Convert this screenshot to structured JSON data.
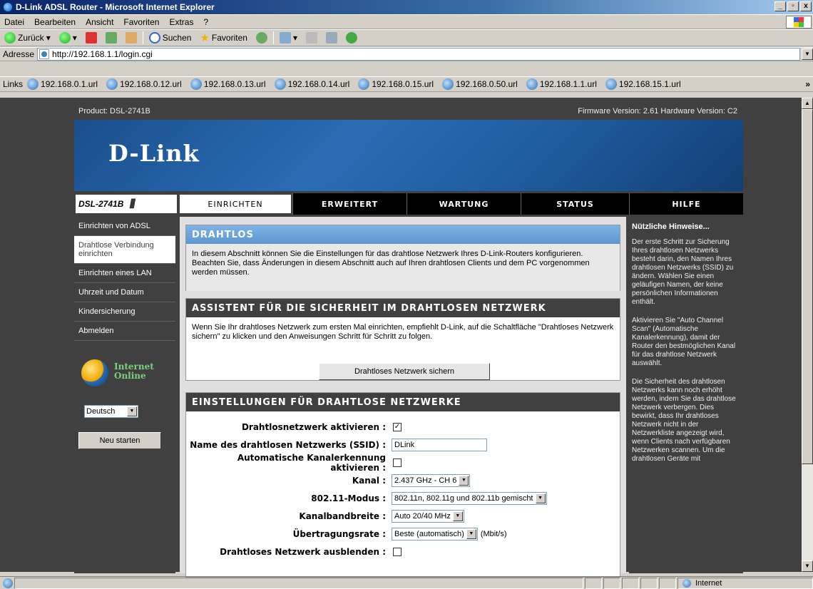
{
  "window": {
    "title": "D-Link ADSL Router - Microsoft Internet Explorer",
    "controls": [
      "_",
      "▫",
      "x"
    ]
  },
  "menubar": [
    "Datei",
    "Bearbeiten",
    "Ansicht",
    "Favoriten",
    "Extras",
    "?"
  ],
  "toolbar": {
    "back": "Zurück",
    "search": "Suchen",
    "favorites": "Favoriten"
  },
  "address": {
    "label": "Adresse",
    "url": "http://192.168.1.1/login.cgi"
  },
  "links": {
    "label": "Links",
    "items": [
      "192.168.0.1.url",
      "192.168.0.12.url",
      "192.168.0.13.url",
      "192.168.0.14.url",
      "192.168.0.15.url",
      "192.168.0.50.url",
      "192.168.1.1.url",
      "192.168.15.1.url"
    ],
    "more": "»"
  },
  "router": {
    "product": "Product: DSL-2741B",
    "firmware": "Firmware Version: 2.61 Hardware Version: C2",
    "logo": "D-Link",
    "model": "DSL-2741B",
    "tabs": [
      "EINRICHTEN",
      "ERWEITERT",
      "WARTUNG",
      "STATUS",
      "HILFE"
    ],
    "nav": [
      "Einrichten von ADSL",
      "Drahtlose Verbindung einrichten",
      "Einrichten eines LAN",
      "Uhrzeit und Datum",
      "Kindersicherung",
      "Abmelden"
    ],
    "internet_status": [
      "Internet",
      "Online"
    ],
    "language": "Deutsch",
    "restart": "Neu starten"
  },
  "section1": {
    "title": "DRAHTLOS",
    "text": "In diesem Abschnitt können Sie die Einstellungen für das drahtlose Netzwerk Ihres D-Link-Routers konfigurieren. Beachten Sie, dass Änderungen in diesem Abschnitt auch auf Ihren drahtlosen Clients und dem PC vorgenommen werden müssen."
  },
  "section2": {
    "title": "ASSISTENT FÜR DIE SICHERHEIT IM DRAHTLOSEN NETZWERK",
    "text": "Wenn Sie Ihr drahtloses Netzwerk zum ersten Mal einrichten, empfiehlt D-Link, auf die Schaltfläche \"Drahtloses Netzwerk sichern\" zu klicken und den Anweisungen Schritt für Schritt zu folgen.",
    "button": "Drahtloses Netzwerk sichern"
  },
  "section3": {
    "title": "EINSTELLUNGEN FÜR DRAHTLOSE NETZWERKE",
    "enable_label": "Drahtlosnetzwerk aktivieren :",
    "enable_checked": "✓",
    "ssid_label": "Name des drahtlosen Netzwerks (SSID) :",
    "ssid_value": "DLink",
    "autochan_label": "Automatische Kanalerkennung aktivieren :",
    "channel_label": "Kanal :",
    "channel_value": "2.437 GHz - CH 6",
    "mode_label": "802.11-Modus :",
    "mode_value": "802.11n, 802.11g und 802.11b gemischt",
    "bandwidth_label": "Kanalbandbreite :",
    "bandwidth_value": "Auto 20/40 MHz",
    "rate_label": "Übertragungsrate :",
    "rate_value": "Beste (automatisch)",
    "rate_unit": "(Mbit/s)",
    "hide_label": "Drahtloses Netzwerk ausblenden :"
  },
  "help": {
    "title": "Nützliche Hinweise...",
    "p1": "Der erste Schritt zur Sicherung Ihres drahtlosen Netzwerks besteht darin, den Namen Ihres drahtlosen Netzwerks (SSID) zu ändern. Wählen Sie einen geläufigen Namen, der keine persönlichen Informationen enthält.",
    "p2": "Aktivieren Sie \"Auto Channel Scan\" (Automatische Kanalerkennung), damit der Router den bestmöglichen Kanal für das drahtlose Netzwerk auswählt.",
    "p3": "Die Sicherheit des drahtlosen Netzwerks kann noch erhöht werden, indem Sie das drahtlose Netzwerk verbergen. Dies bewirkt, dass Ihr drahtloses Netzwerk nicht in der Netzwerkliste angezeigt wird, wenn Clients nach verfügbaren Netzwerken scannen. Um die drahtlosen Geräte mit"
  },
  "status": {
    "zone": "Internet"
  }
}
